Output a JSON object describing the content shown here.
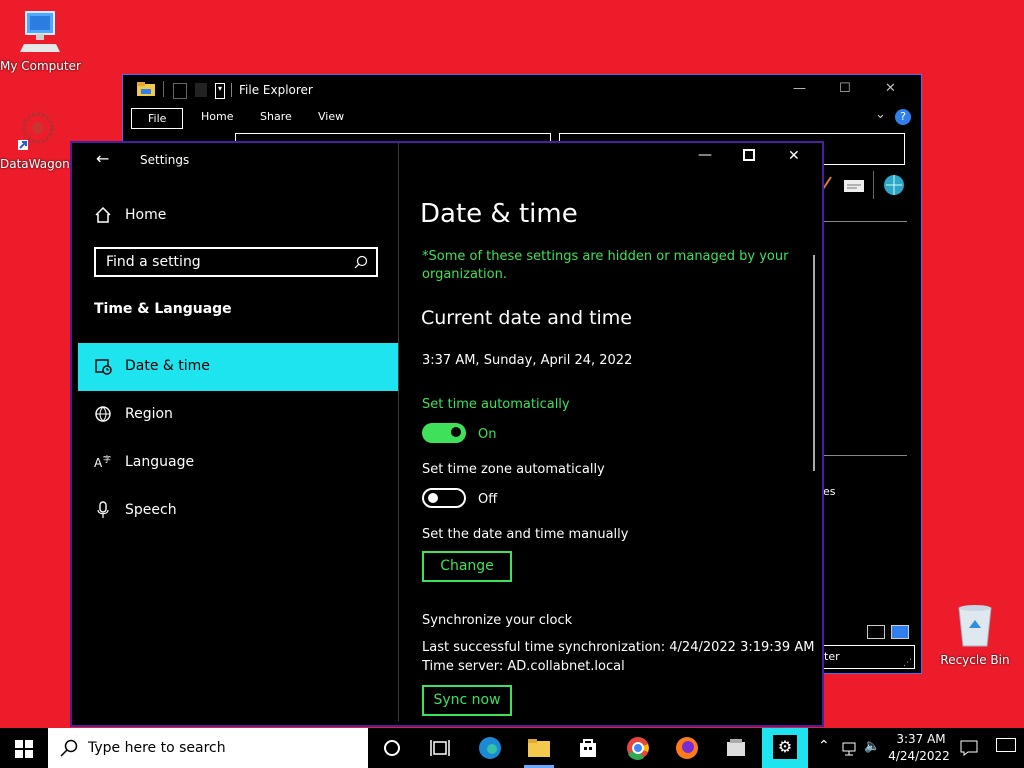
{
  "desktop": {
    "icons": [
      {
        "label": "My Computer"
      },
      {
        "label": "DataWagon..."
      },
      {
        "label": "Recycle Bin"
      }
    ]
  },
  "explorer": {
    "title": "File Explorer",
    "tabs": [
      "File",
      "Home",
      "Share",
      "View"
    ],
    "partial_texts": [
      "es",
      "ter"
    ]
  },
  "settings": {
    "window_title": "Settings",
    "home_label": "Home",
    "search_placeholder": "Find a setting",
    "section_title": "Time & Language",
    "nav": [
      {
        "label": "Date & time",
        "icon": "date-time-icon",
        "active": true
      },
      {
        "label": "Region",
        "icon": "globe-icon",
        "active": false
      },
      {
        "label": "Language",
        "icon": "language-icon",
        "active": false
      },
      {
        "label": "Speech",
        "icon": "microphone-icon",
        "active": false
      }
    ],
    "page_title": "Date & time",
    "managed_notice": "*Some of these settings are hidden or managed by your organization.",
    "current_heading": "Current date and time",
    "current_value": "3:37 AM, Sunday, April 24, 2022",
    "set_time_auto_label": "Set time automatically",
    "set_time_auto_state": "On",
    "set_zone_auto_label": "Set time zone automatically",
    "set_zone_auto_state": "Off",
    "manual_label": "Set the date and time manually",
    "change_button": "Change",
    "sync_heading": "Synchronize your clock",
    "last_sync": "Last successful time synchronization: 4/24/2022 3:19:39 AM",
    "time_server": "Time server: AD.collabnet.local",
    "sync_button": "Sync now"
  },
  "taskbar": {
    "search_placeholder": "Type here to search",
    "clock_time": "3:37 AM",
    "clock_date": "4/24/2022"
  },
  "colors": {
    "desktop": "#ec1c2b",
    "accent_cyan": "#1ee4f0",
    "green": "#3fe05a",
    "window_border": "#4b1e9f"
  }
}
